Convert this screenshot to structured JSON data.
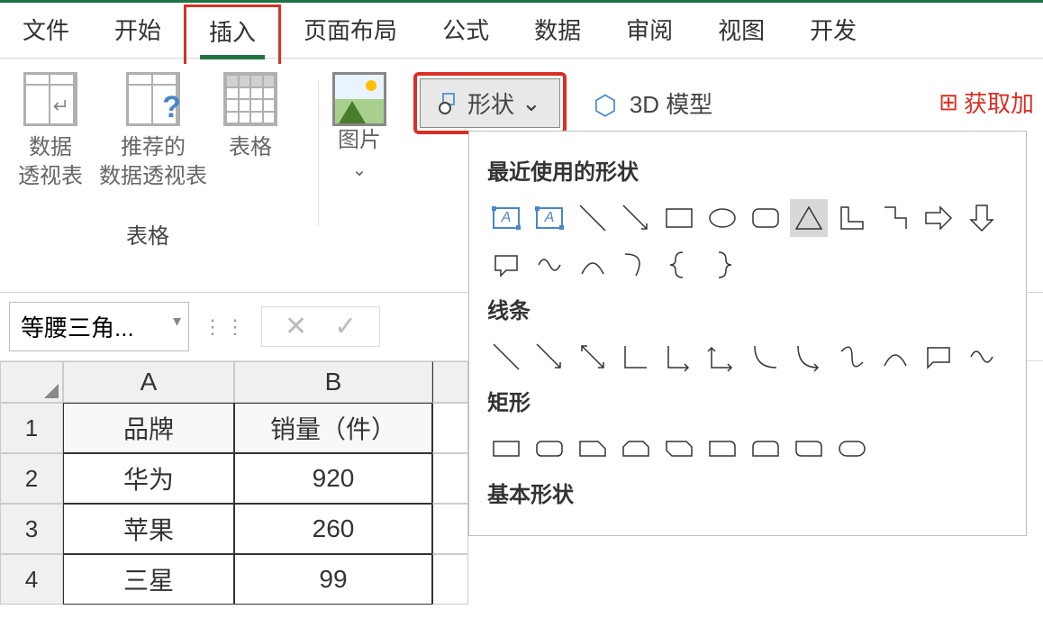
{
  "tabs": {
    "file": "文件",
    "home": "开始",
    "insert": "插入",
    "pagelayout": "页面布局",
    "formulas": "公式",
    "data": "数据",
    "review": "审阅",
    "view": "视图",
    "developer": "开发"
  },
  "ribbon": {
    "pivot_table": "数据\n透视表",
    "recommended_pivot": "推荐的\n数据透视表",
    "table": "表格",
    "group_tables": "表格",
    "pictures": "图片",
    "shapes": "形状",
    "model3d": "3D 模型",
    "addins": "获取加"
  },
  "shapes_panel": {
    "recent": "最近使用的形状",
    "lines": "线条",
    "rectangles": "矩形",
    "basic": "基本形状"
  },
  "namebox": "等腰三角...",
  "sheet": {
    "columns": [
      "A",
      "B"
    ],
    "rows": [
      "1",
      "2",
      "3",
      "4"
    ],
    "header_a": "品牌",
    "header_b": "销量（件）",
    "data": [
      {
        "brand": "华为",
        "sales": "920"
      },
      {
        "brand": "苹果",
        "sales": "260"
      },
      {
        "brand": "三星",
        "sales": "99"
      }
    ]
  }
}
